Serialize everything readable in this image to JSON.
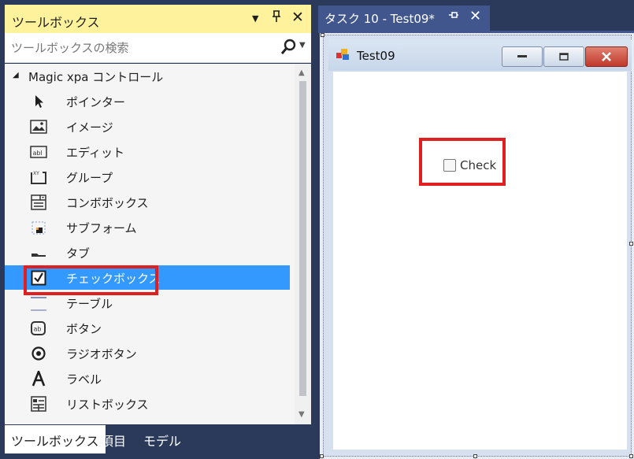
{
  "toolbox": {
    "title": "ツールボックス",
    "search": {
      "placeholder": "ツールボックスの検索"
    },
    "group": "Magic xpa コントロール",
    "items": [
      {
        "label": "ポインター",
        "icon": "pointer-icon"
      },
      {
        "label": "イメージ",
        "icon": "image-icon"
      },
      {
        "label": "エディット",
        "icon": "edit-icon"
      },
      {
        "label": "グループ",
        "icon": "group-icon"
      },
      {
        "label": "コンボボックス",
        "icon": "combobox-icon"
      },
      {
        "label": "サブフォーム",
        "icon": "subform-icon"
      },
      {
        "label": "タブ",
        "icon": "tab-icon"
      },
      {
        "label": "チェックボックス",
        "icon": "checkbox-icon",
        "selected": true
      },
      {
        "label": "テーブル",
        "icon": "table-icon"
      },
      {
        "label": "ボタン",
        "icon": "button-icon"
      },
      {
        "label": "ラジオボタン",
        "icon": "radio-button-icon"
      },
      {
        "label": "ラベル",
        "icon": "label-icon"
      },
      {
        "label": "リストボックス",
        "icon": "listbox-icon"
      }
    ],
    "bottom_tabs": [
      {
        "label": "ツールボックス",
        "active": true
      },
      {
        "label": "項目"
      },
      {
        "label": "モデル"
      }
    ]
  },
  "document": {
    "tab_title": "タスク 10 - Test09*"
  },
  "form": {
    "title": "Test09",
    "checkbox_label": "Check"
  },
  "colors": {
    "selection": "#3399ff",
    "highlight": "#e02020",
    "header": "#fff29d",
    "background": "#2b3a5a"
  }
}
